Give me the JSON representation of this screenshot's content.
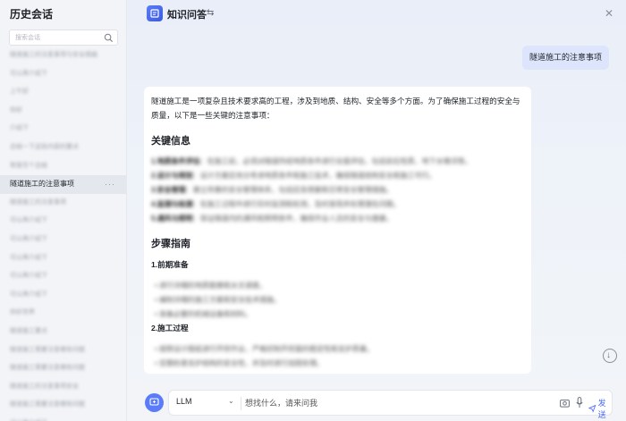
{
  "sidebar": {
    "title": "历史会话",
    "search_placeholder": "搜索会话",
    "items": [
      {
        "label": "隧道施工的注意事项与安全措施",
        "blurred": true
      },
      {
        "label": "可以再介绍下",
        "blurred": true
      },
      {
        "label": "上午好",
        "blurred": true
      },
      {
        "label": "你好",
        "blurred": true
      },
      {
        "label": "介绍下",
        "blurred": true
      },
      {
        "label": "总结一下这段内容的要点",
        "blurred": true
      },
      {
        "label": "帮我写个总结",
        "blurred": true
      },
      {
        "label": "隧道施工的注意事项",
        "blurred": false,
        "active": true
      },
      {
        "label": "隧道施工的注意事项",
        "blurred": true
      },
      {
        "label": "可以再介绍下",
        "blurred": true
      },
      {
        "label": "可以再介绍下",
        "blurred": true
      },
      {
        "label": "可以再介绍下",
        "blurred": true
      },
      {
        "label": "可以再介绍下",
        "blurred": true
      },
      {
        "label": "可以再介绍下",
        "blurred": true
      },
      {
        "label": "你好世界",
        "blurred": true
      },
      {
        "label": "隧道施工要点",
        "blurred": true
      },
      {
        "label": "隧道施工需要注意哪些问题",
        "blurred": true
      },
      {
        "label": "隧道施工需要注意哪些问题",
        "blurred": true
      },
      {
        "label": "隧道施工的注意事项安全",
        "blurred": true
      },
      {
        "label": "隧道施工需要注意哪些问题",
        "blurred": true
      },
      {
        "label": "可以再介绍下",
        "blurred": true
      }
    ],
    "more_label": "···"
  },
  "header": {
    "title": "知识问答",
    "swap_symbol": "⇆",
    "close_symbol": "✕"
  },
  "conversation": {
    "user_message": "隧道施工的注意事项",
    "answer": {
      "intro": "隧道施工是一项复杂且技术要求高的工程，涉及到地质、结构、安全等多个方面。为了确保施工过程的安全与质量，以下是一些关键的注意事项：",
      "key_heading": "关键信息",
      "key_items": [
        {
          "bold": "1.地质条件评估",
          "text": "：在施工前，必须对隧道所经地质条件进行全面评估，包括岩石性质、地下水情况等。"
        },
        {
          "bold": "2.设计与规划",
          "text": "：设计方案应充分考虑地质条件和施工技术，确保隧道结构安全和施工可行。"
        },
        {
          "bold": "3.安全管理",
          "text": "：建立完善的安全管理体系，包括应急预案和日常安全管理措施。"
        },
        {
          "bold": "4.监测与检测",
          "text": "：在施工过程中进行实时监测和检测，及时发现并处理潜在问题。"
        },
        {
          "bold": "5.通风与照明",
          "text": "：保证隧道内的通风和照明条件，确保作业人员的安全与健康。"
        }
      ],
      "steps_heading": "步骤指南",
      "step1_title": "1.前期准备",
      "step1_items": [
        "进行详细的地质勘察和水文调查。",
        "编制详细的施工方案和安全技术措施。",
        "准备必要的机械设备和材料。"
      ],
      "step2_title": "2.施工过程",
      "step2_items": [
        "按照设计图纸进行开挖作业，严格控制开挖面的稳定性和支护质量。",
        "定期检查支护结构的安全性，并及时进行加固处理。"
      ]
    }
  },
  "input": {
    "model": "LLM",
    "placeholder": "想找什么，请来问我",
    "send_label": "发送"
  },
  "colors": {
    "accent": "#4a6cf7",
    "user_bubble": "#dce5fb",
    "sidebar_active": "#e4e7ee"
  }
}
